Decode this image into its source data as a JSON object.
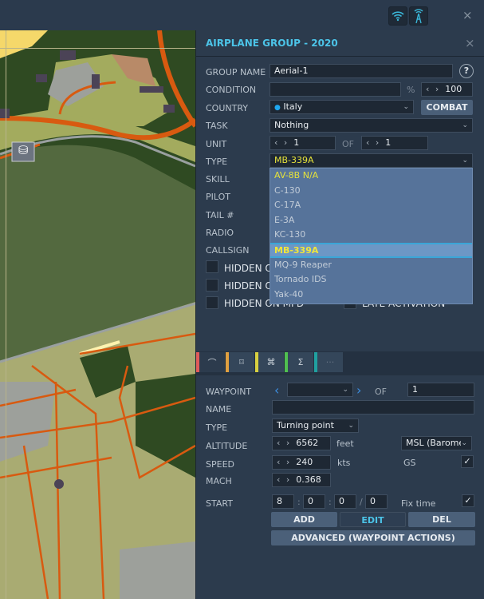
{
  "topbar": {
    "icons": [
      "wifi-icon",
      "radio-tower-icon"
    ],
    "close": "×"
  },
  "panel": {
    "title": "AIRPLANE GROUP - 2020",
    "close": "×"
  },
  "group": {
    "group_name_label": "GROUP NAME",
    "group_name": "Aerial-1",
    "help": "?",
    "condition_label": "CONDITION",
    "condition_value": "",
    "percent": "%",
    "condition_pct": "100",
    "country_label": "COUNTRY",
    "country": "Italy",
    "combat": "COMBAT",
    "country_color": "#1ea7f0",
    "task_label": "TASK",
    "task": "Nothing",
    "unit_label": "UNIT",
    "unit": "1",
    "of": "OF",
    "unit_total": "1",
    "type_label": "TYPE",
    "type": "MB-339A",
    "skill_label": "SKILL",
    "pilot_label": "PILOT",
    "tail_label": "TAIL #",
    "radio_label": "RADIO",
    "callsign_label": "CALLSIGN",
    "hidden1": "HIDDEN ON",
    "hidden2": "HIDDEN ON",
    "hidden3": "HIDDEN ON MFD",
    "late": "LATE ACTIVATION"
  },
  "type_dropdown": {
    "options": [
      "AV-8B N/A",
      "C-130",
      "C-17A",
      "E-3A",
      "KC-130",
      "MB-339A",
      "MQ-9 Reaper",
      "Tornado IDS",
      "Yak-40"
    ],
    "selected": "MB-339A"
  },
  "tabs": [
    {
      "icon": "route-icon",
      "color": "#e05a5a"
    },
    {
      "icon": "target-icon",
      "color": "#e0a040"
    },
    {
      "icon": "command-icon",
      "color": "#d8d040"
    },
    {
      "icon": "sigma-icon",
      "color": "#50c050"
    },
    {
      "icon": "more-icon",
      "color": "#20a0a0"
    }
  ],
  "waypoint": {
    "waypoint_label": "WAYPOINT",
    "waypoint": "",
    "of": "OF",
    "total": "1",
    "name_label": "NAME",
    "name": "",
    "type_label": "TYPE",
    "type": "Turning point",
    "altitude_label": "ALTITUDE",
    "altitude": "6562",
    "altitude_unit": "feet",
    "altitude_ref": "MSL (Barome",
    "speed_label": "SPEED",
    "speed": "240",
    "speed_unit": "kts",
    "gs_label": "GS",
    "gs_checked": true,
    "mach_label": "MACH",
    "mach": "0.368",
    "start_label": "START",
    "start_h": "8",
    "start_m": "0",
    "start_s": "0",
    "start_d": "0",
    "fix_time": "Fix time",
    "fix_checked": true,
    "add": "ADD",
    "edit": "EDIT",
    "del": "DEL",
    "advanced": "ADVANCED (WAYPOINT ACTIONS)"
  }
}
